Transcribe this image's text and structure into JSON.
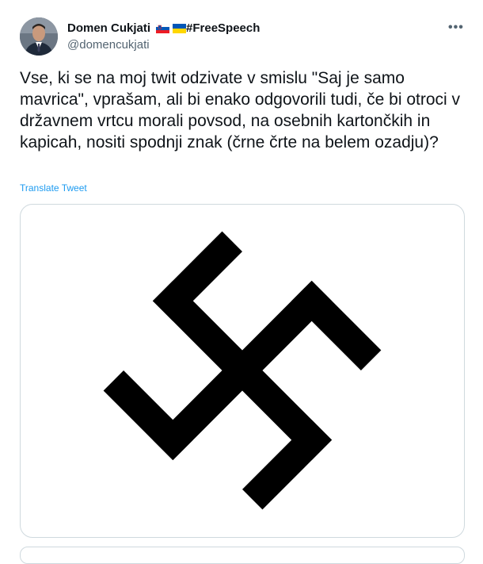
{
  "author": {
    "display_name": "Domen Cukjati",
    "handle": "@domencukjati",
    "name_suffix": "#FreeSpeech",
    "flags": [
      "slovenia-flag",
      "ukraine-flag"
    ]
  },
  "more_label": "•••",
  "tweet": {
    "text": "Vse, ki se na moj twit odzivate v smislu \"Saj je samo mavrica\", vprašam, ali bi enako odgovorili tudi, če bi otroci v državnem vrtcu morali povsod, na osebnih kartončkih in kapicah, nositi spodnji znak (črne črte na belem ozadju)?",
    "translate_label": "Translate Tweet"
  },
  "colors": {
    "link": "#1d9bf0",
    "secondary_text": "#536471",
    "border": "#cfd9de",
    "symbol": "#000000"
  }
}
